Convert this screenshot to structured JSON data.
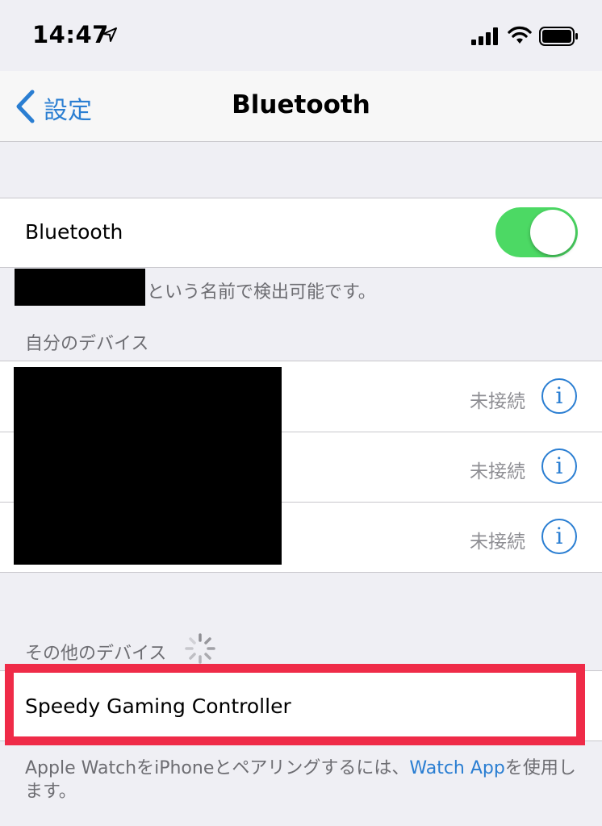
{
  "status_bar": {
    "time": "14:47",
    "icons": [
      "location-arrow-icon",
      "signal-icon",
      "wifi-icon",
      "battery-icon"
    ]
  },
  "nav": {
    "back_label": "設定",
    "title": "Bluetooth"
  },
  "bluetooth": {
    "label": "Bluetooth",
    "enabled": true,
    "discoverable_suffix": "という名前で検出可能です。"
  },
  "my_devices": {
    "header": "自分のデバイス",
    "items": [
      {
        "status": "未接続"
      },
      {
        "status": "未接続"
      },
      {
        "status": "未接続"
      }
    ]
  },
  "other_devices": {
    "header": "その他のデバイス",
    "items": [
      {
        "label": "Speedy Gaming Controller"
      }
    ]
  },
  "footer": {
    "text_before": "Apple WatchをiPhoneとペアリングするには、",
    "link": "Watch App",
    "text_after": "を使用します。"
  },
  "colors": {
    "accent": "#2a7ed2",
    "toggle_on": "#4cd964",
    "highlight": "#ef2b48",
    "background": "#efeff4"
  }
}
